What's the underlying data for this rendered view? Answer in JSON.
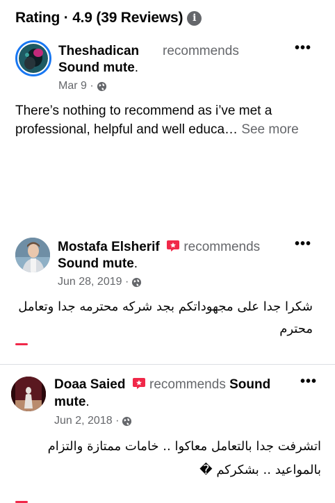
{
  "header": {
    "title": "Rating · 4.9 (39 Reviews)",
    "info_icon": "info-icon"
  },
  "reviews": [
    {
      "name": "Theshadican",
      "recommends": "recommends",
      "page": "Sound mute",
      "period": ".",
      "date": "Mar 9 ·",
      "text": "There’s nothing to recommend as i’ve met a professional, helpful and well educa…",
      "see_more": "See more",
      "more_icon": "•••"
    },
    {
      "name": "Mostafa Elsherif",
      "recommends": "recommends",
      "page": "Sound mute",
      "period": ".",
      "date": "Jun 28, 2019 ·",
      "text": "شكرا جدا على مجهوداتكم بجد شركه محترمه جدا وتعامل محترم",
      "more_icon": "•••"
    },
    {
      "name": "Doaa Saied",
      "recommends": "recommends",
      "page_part1": "Sound",
      "page_part2": "mute",
      "period": ".",
      "date": "Jun 2, 2018 ·",
      "text": "اتشرفت جدا بالتعامل معاكوا .. خامات ممتازة والتزام بالمواعيد .. بشكركم �",
      "more_icon": "•••"
    }
  ],
  "colors": {
    "text": "#050505",
    "secondary": "#65676b",
    "badge": "#f02849",
    "avatar_ring": "#1877f2"
  }
}
